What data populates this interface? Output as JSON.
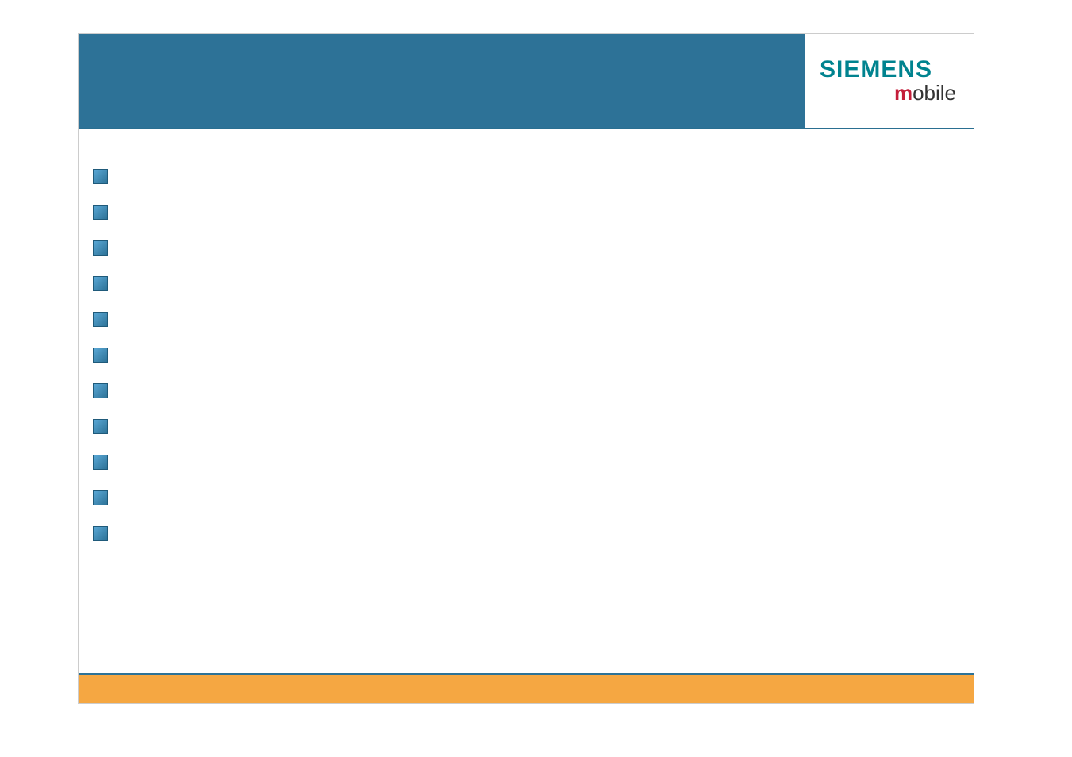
{
  "brand": {
    "main": "SIEMENS",
    "sub_prefix": "m",
    "sub_rest": "obile"
  },
  "bullets": [
    {
      "text": ""
    },
    {
      "text": ""
    },
    {
      "text": ""
    },
    {
      "text": ""
    },
    {
      "text": ""
    },
    {
      "text": ""
    },
    {
      "text": ""
    },
    {
      "text": ""
    },
    {
      "text": ""
    },
    {
      "text": ""
    },
    {
      "text": ""
    }
  ]
}
